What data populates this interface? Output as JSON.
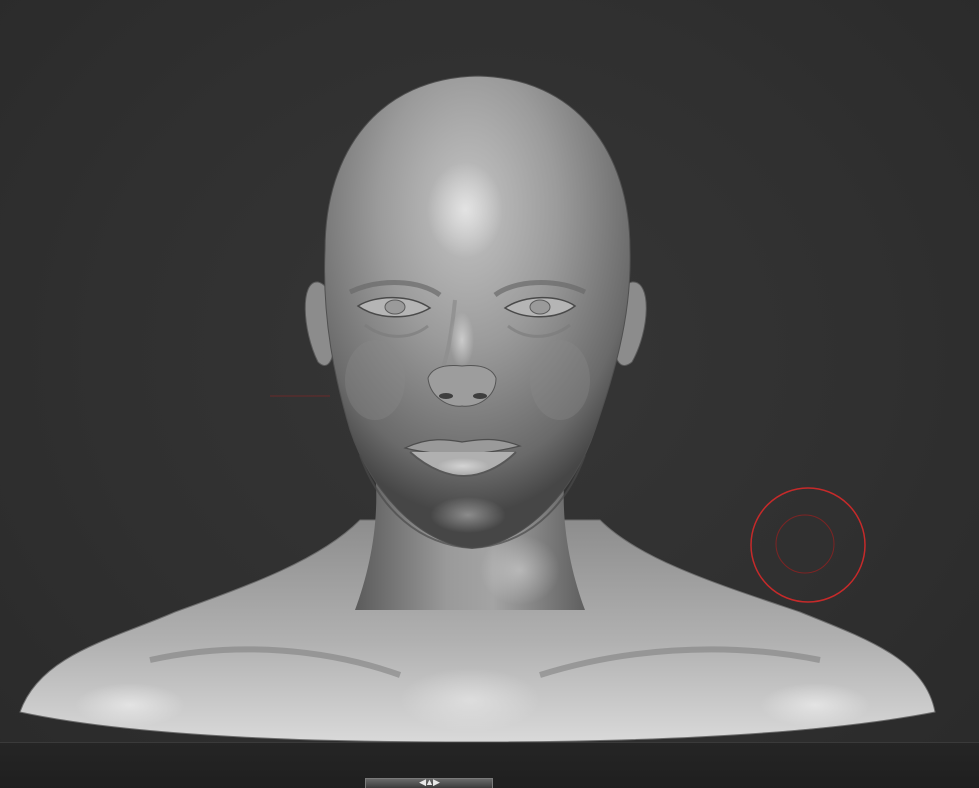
{
  "viewport": {
    "background": "#2f2f2f",
    "model_color": "#a8a8a8",
    "floor_color": "#222222"
  },
  "brush_cursor": {
    "color": "#c62a2a",
    "icon": "brush-circle-icon"
  },
  "bottom_handle": {
    "icon": "expand-arrows-icon",
    "glyph": "◀▲▶"
  }
}
